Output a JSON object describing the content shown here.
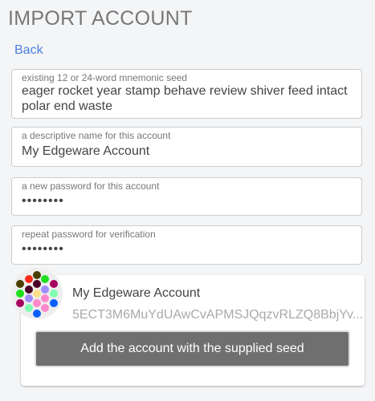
{
  "title": "IMPORT ACCOUNT",
  "back_label": "Back",
  "fields": [
    {
      "label": "existing 12 or 24-word mnemonic seed",
      "value": "eager rocket year stamp behave review shiver feed intact polar end waste"
    },
    {
      "label": "a descriptive name for this account",
      "value": "My Edgeware Account"
    },
    {
      "label": "a new password for this account",
      "value": "••••••••"
    },
    {
      "label": "repeat password for verification",
      "value": "••••••••"
    }
  ],
  "account": {
    "name": "My Edgeware Account",
    "address": "5ECT3M6MuYdUAwCvAPMSJQqzvRLZQ8BbjYv...",
    "identicon_colors": [
      "#4a3f00",
      "#ff2a1a",
      "#1ee01e",
      "#4a3f00",
      "#4a0025",
      "#a8005e",
      "#4a0025",
      "#a08cff",
      "#1ee01e",
      "#ffe08a",
      "#80ffb0",
      "#a08cff",
      "#ff88cc",
      "#a8005e",
      "#ff88cc",
      "#0a60ff",
      "#80ffb0",
      "#ff88cc",
      "#0a60ff"
    ]
  },
  "button_label": "Add the account with the supplied seed"
}
